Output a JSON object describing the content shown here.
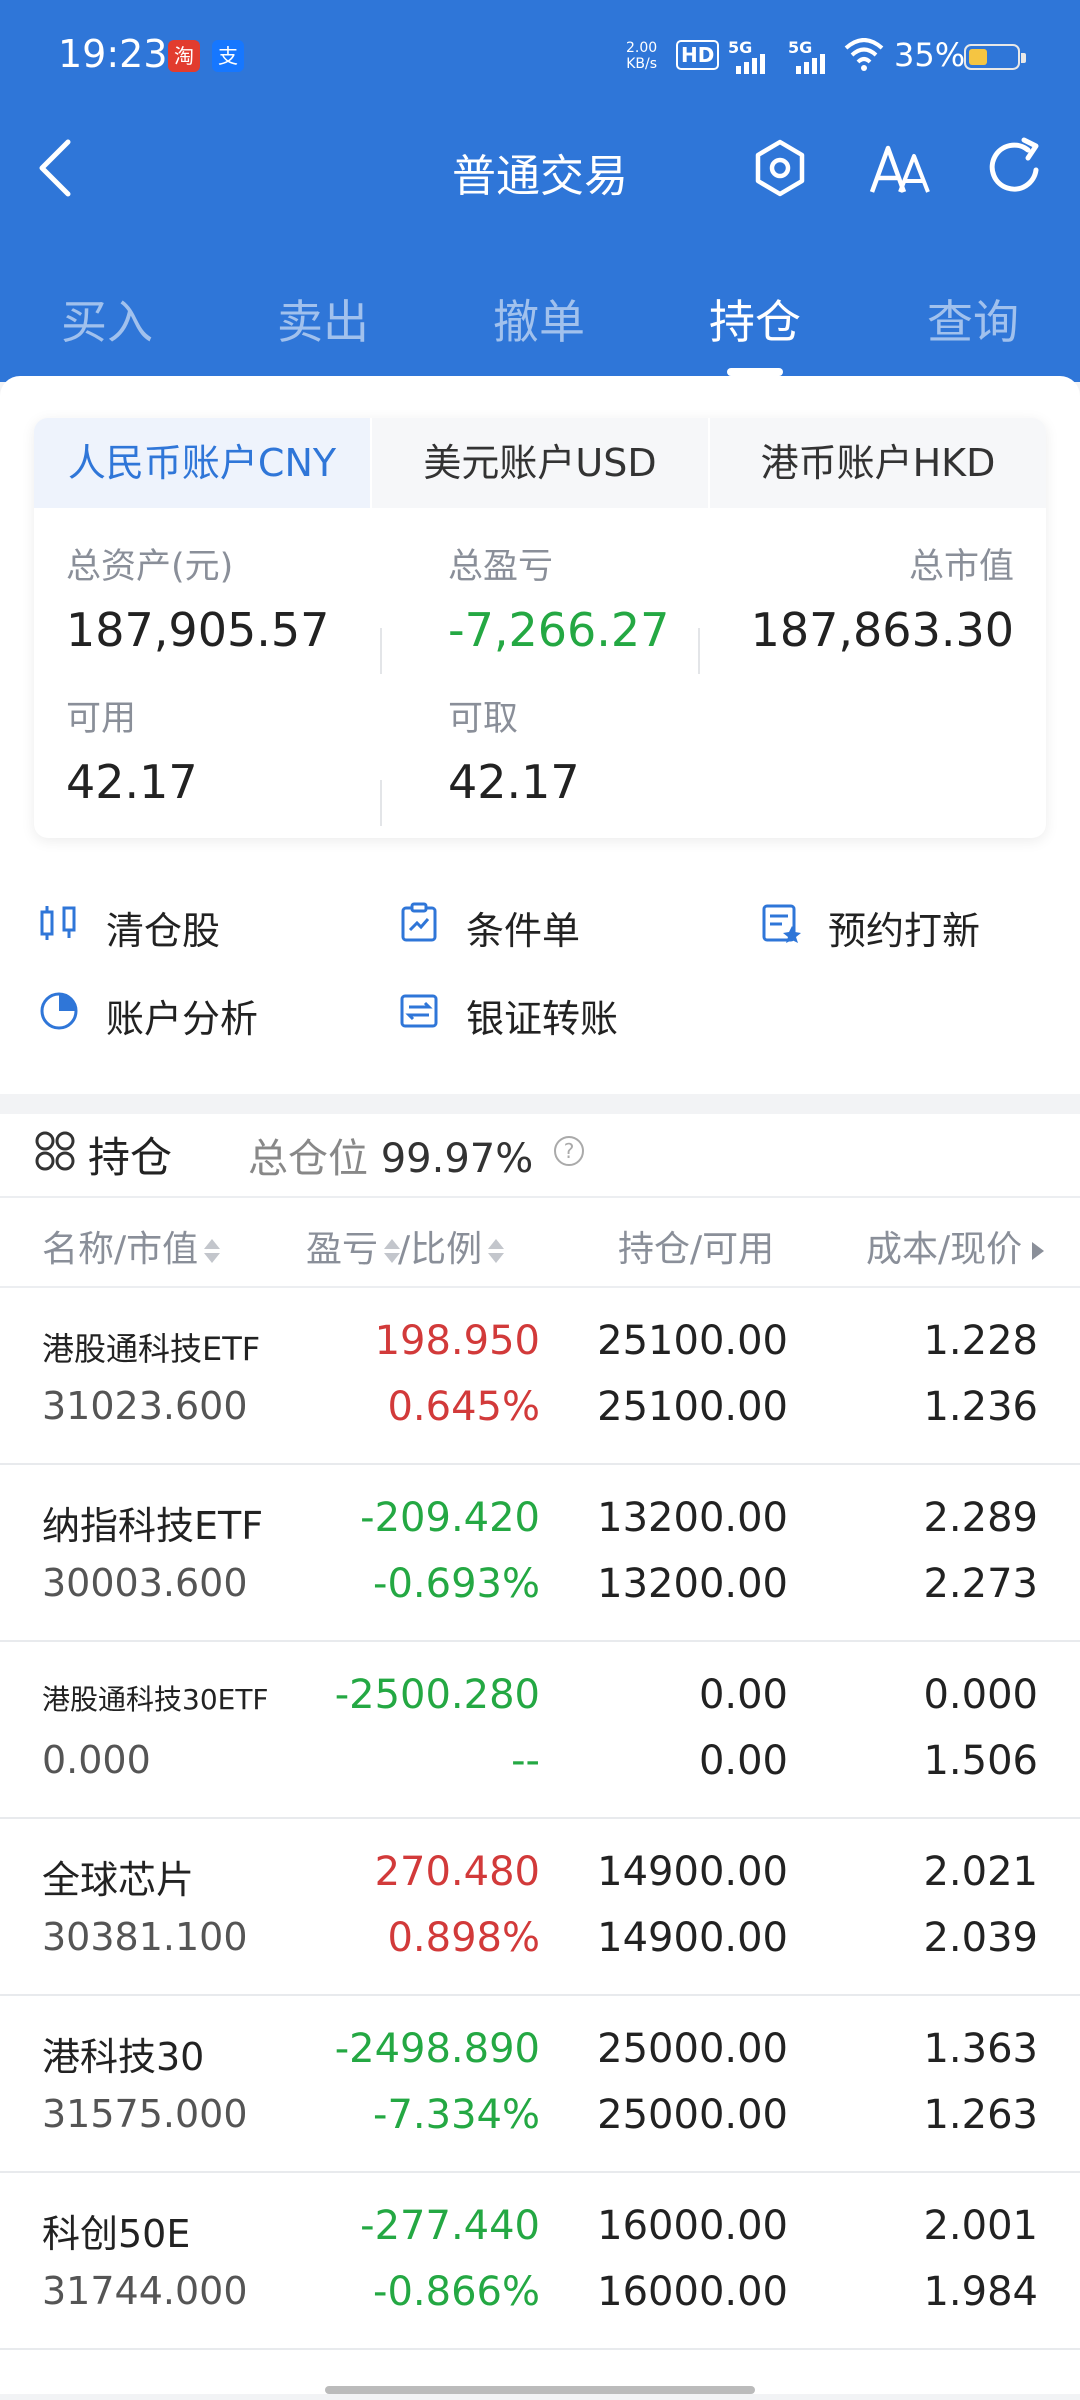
{
  "status": {
    "time": "19:23",
    "app_icons": [
      "淘",
      "支"
    ],
    "net_speed": "2.00",
    "net_unit": "KB/s",
    "hd_label": "HD",
    "signal_labels": [
      "5G",
      "5G"
    ],
    "battery": "35%",
    "battery_level": 0.35
  },
  "navbar": {
    "title": "普通交易",
    "icons": [
      "back-icon",
      "settings-hex-icon",
      "font-size-icon",
      "refresh-icon"
    ]
  },
  "tabs": [
    {
      "label": "买入"
    },
    {
      "label": "卖出"
    },
    {
      "label": "撤单"
    },
    {
      "label": "持仓",
      "active": true
    },
    {
      "label": "查询"
    }
  ],
  "account": {
    "tabs": [
      "人民币账户CNY",
      "美元账户USD",
      "港币账户HKD"
    ],
    "active_tab": 0,
    "metrics": {
      "total_assets": {
        "label": "总资产(元)",
        "value": "187,905.57"
      },
      "total_pl": {
        "label": "总盈亏",
        "value": "-7,266.27"
      },
      "market_value": {
        "label": "总市值",
        "value": "187,863.30"
      },
      "available": {
        "label": "可用",
        "value": "42.17"
      },
      "withdrawable": {
        "label": "可取",
        "value": "42.17"
      }
    }
  },
  "quick_actions": [
    {
      "label": "清仓股",
      "icon": "clear-position-icon"
    },
    {
      "label": "条件单",
      "icon": "conditional-order-icon"
    },
    {
      "label": "预约打新",
      "icon": "ipo-reserve-icon"
    },
    {
      "label": "账户分析",
      "icon": "pie-chart-icon"
    },
    {
      "label": "银证转账",
      "icon": "transfer-icon"
    }
  ],
  "holdings": {
    "title": "持仓",
    "position_label": "总仓位",
    "position_value": "99.97%",
    "help": "?",
    "columns": {
      "name": "名称/市值",
      "pl": "盈亏",
      "ratio": "/比例",
      "hold": "持仓/可用",
      "cost": "成本/现价"
    },
    "rows": [
      {
        "name": "港股通科技ETF",
        "mv": "31023.600",
        "pl": "198.950",
        "pct": "0.645%",
        "hold": "25100.00",
        "avail": "25100.00",
        "cost": "1.228",
        "price": "1.236",
        "dir": "pos"
      },
      {
        "name": "纳指科技ETF",
        "mv": "30003.600",
        "pl": "-209.420",
        "pct": "-0.693%",
        "hold": "13200.00",
        "avail": "13200.00",
        "cost": "2.289",
        "price": "2.273",
        "dir": "neg"
      },
      {
        "name": "港股通科技30ETF",
        "mv": "0.000",
        "pl": "-2500.280",
        "pct": "--",
        "hold": "0.00",
        "avail": "0.00",
        "cost": "0.000",
        "price": "1.506",
        "dir": "neg"
      },
      {
        "name": "全球芯片",
        "mv": "30381.100",
        "pl": "270.480",
        "pct": "0.898%",
        "hold": "14900.00",
        "avail": "14900.00",
        "cost": "2.021",
        "price": "2.039",
        "dir": "pos"
      },
      {
        "name": "港科技30",
        "mv": "31575.000",
        "pl": "-2498.890",
        "pct": "-7.334%",
        "hold": "25000.00",
        "avail": "25000.00",
        "cost": "1.363",
        "price": "1.263",
        "dir": "neg"
      },
      {
        "name": "科创50E",
        "mv": "31744.000",
        "pl": "-277.440",
        "pct": "-0.866%",
        "hold": "16000.00",
        "avail": "16000.00",
        "cost": "2.001",
        "price": "1.984",
        "dir": "neg"
      }
    ]
  },
  "colors": {
    "header_blue": "#2f76d8",
    "gain_red": "#d23a3a",
    "loss_green": "#24a843"
  }
}
